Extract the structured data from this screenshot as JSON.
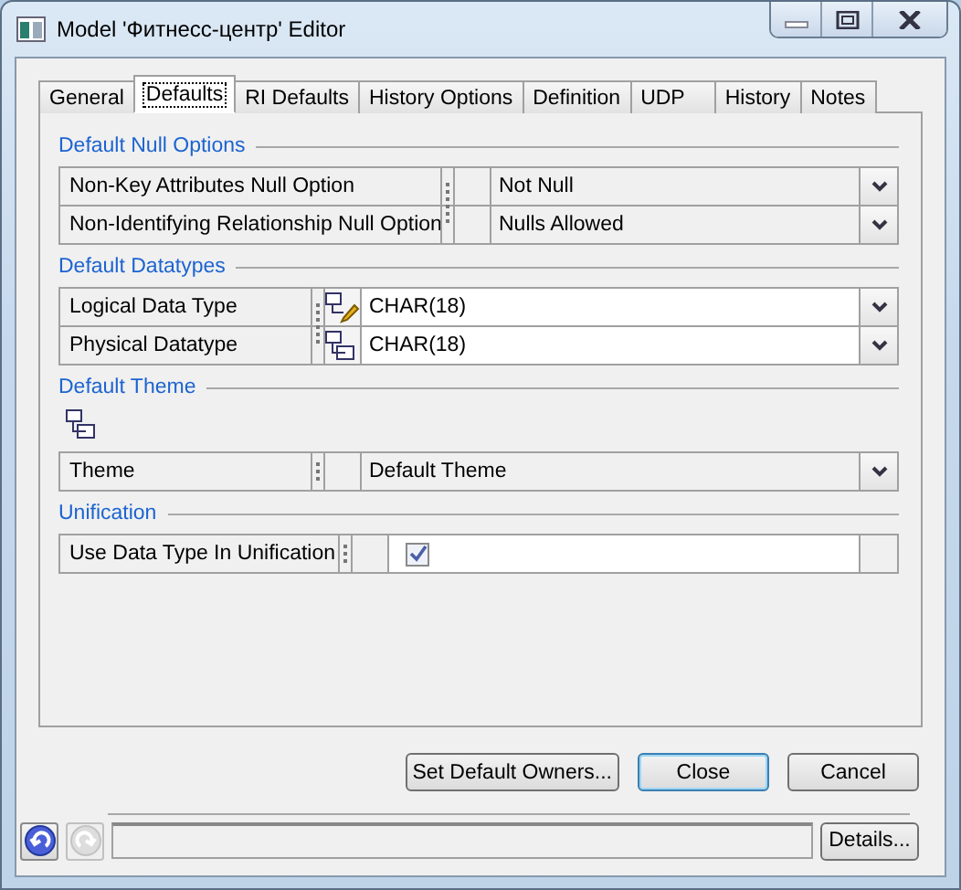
{
  "window": {
    "title": "Model 'Фитнесс-центр' Editor"
  },
  "tabs": [
    {
      "label": "General",
      "selected": false
    },
    {
      "label": "Defaults",
      "selected": true
    },
    {
      "label": "RI Defaults",
      "selected": false
    },
    {
      "label": "History Options",
      "selected": false
    },
    {
      "label": "Definition",
      "selected": false
    },
    {
      "label": "UDP",
      "selected": false
    },
    {
      "label": "History",
      "selected": false
    },
    {
      "label": "Notes",
      "selected": false
    }
  ],
  "sections": [
    {
      "title": "Default Null Options",
      "kind": "plain",
      "rows": [
        {
          "kind": "dropdown",
          "label": "Non-Key Attributes Null Option",
          "value": "Not Null"
        },
        {
          "kind": "dropdown",
          "label": "Non-Identifying Relationship Null Option",
          "value": "Nulls Allowed"
        }
      ]
    },
    {
      "title": "Default Datatypes",
      "kind": "plain",
      "rows": [
        {
          "kind": "typed-dropdown",
          "label": "Logical Data Type",
          "value": "CHAR(18)"
        },
        {
          "kind": "typed-dropdown",
          "label": "Physical Datatype",
          "value": "CHAR(18)"
        }
      ]
    },
    {
      "title": "Default Theme",
      "kind": "toolbar",
      "rows": [
        {
          "kind": "dropdown",
          "label": "Theme",
          "value": "Default Theme"
        }
      ]
    },
    {
      "title": "Unification",
      "kind": "plain",
      "rows": [
        {
          "kind": "checkbox",
          "label": "Use Data Type In Unification",
          "checked": true
        }
      ]
    }
  ],
  "buttons": [
    {
      "label": "Set Default Owners...",
      "default": false
    },
    {
      "label": "Close",
      "default": true
    },
    {
      "label": "Cancel",
      "default": false
    }
  ],
  "status_bar": {
    "undo": {
      "disabled": false
    },
    "redo": {
      "disabled": true
    },
    "details_button": "Details..."
  }
}
